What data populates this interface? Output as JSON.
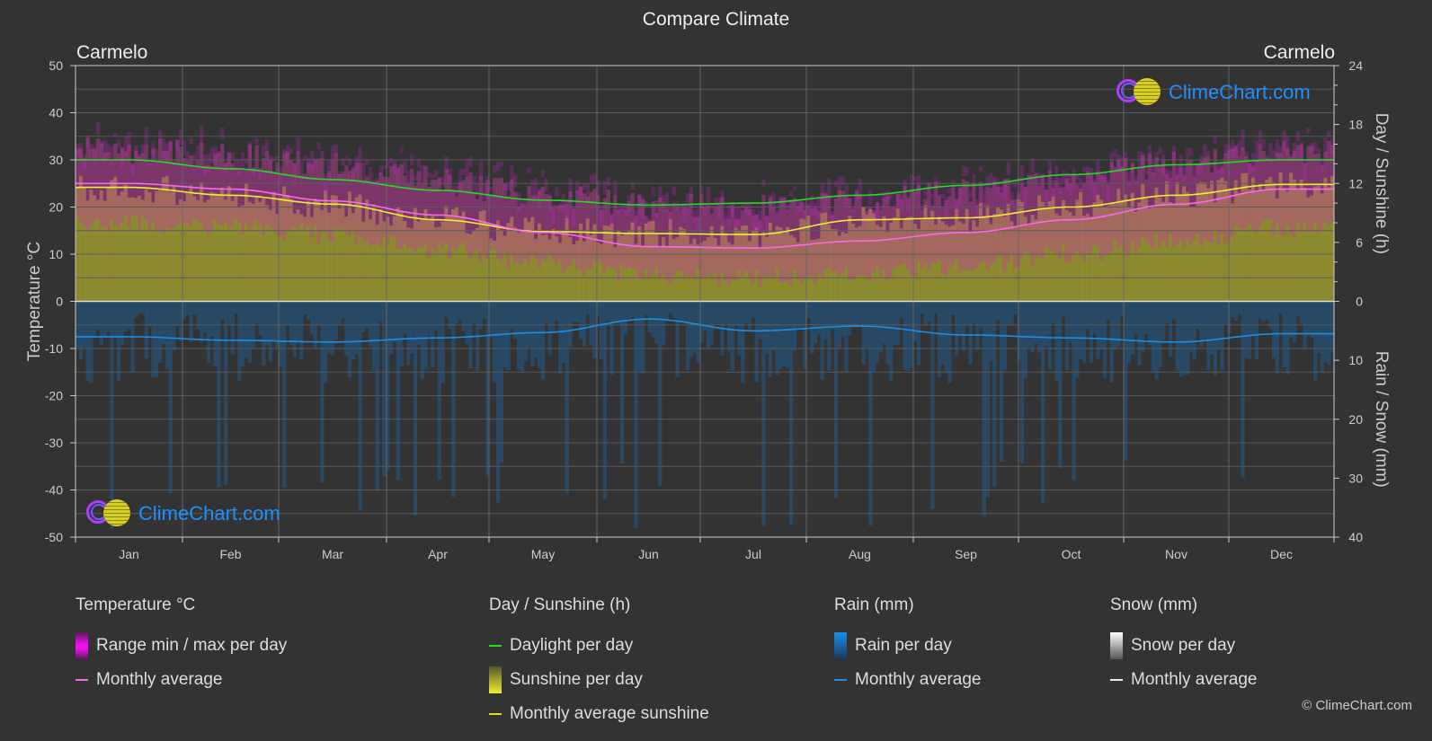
{
  "title": "Compare Climate",
  "location_left": "Carmelo",
  "location_right": "Carmelo",
  "watermark": "ClimeChart.com",
  "copyright": "© ClimeChart.com",
  "legend": {
    "temperature": {
      "title": "Temperature °C",
      "range": "Range min / max per day",
      "avg": "Monthly average"
    },
    "sunshine": {
      "title": "Day / Sunshine (h)",
      "daylight": "Daylight per day",
      "sunshine": "Sunshine per day",
      "avg": "Monthly average sunshine"
    },
    "rain": {
      "title": "Rain (mm)",
      "per_day": "Rain per day",
      "avg": "Monthly average"
    },
    "snow": {
      "title": "Snow (mm)",
      "per_day": "Snow per day",
      "avg": "Monthly average"
    }
  },
  "colors": {
    "daylight": "#22dd22",
    "sunshine_avg": "#eeee33",
    "temp_avg": "#ff66ee",
    "rain_avg": "#1a8fe8",
    "temp_range": "#cc22cc",
    "sunshine_fill": "#9a9a2a",
    "rain_fill": "#1f5a8a",
    "grid": "#5a5a5a",
    "axis": "#cccccc"
  },
  "chart_data": {
    "type": "area",
    "title": "Compare Climate",
    "categories": [
      "Jan",
      "Feb",
      "Mar",
      "Apr",
      "May",
      "Jun",
      "Jul",
      "Aug",
      "Sep",
      "Oct",
      "Nov",
      "Dec"
    ],
    "y_left": {
      "label": "Temperature °C",
      "range": [
        -50,
        50
      ],
      "ticks": [
        50,
        40,
        30,
        20,
        10,
        0,
        -10,
        -20,
        -30,
        -40,
        -50
      ]
    },
    "y_right_top": {
      "label": "Day / Sunshine (h)",
      "range": [
        0,
        24
      ],
      "ticks": [
        24,
        18,
        12,
        6,
        0
      ]
    },
    "y_right_bottom": {
      "label": "Rain / Snow (mm)",
      "range": [
        0,
        40
      ],
      "ticks": [
        0,
        10,
        20,
        30,
        40
      ]
    },
    "grid": true,
    "legend": "bottom",
    "series": [
      {
        "name": "Daylight per day",
        "axis": "hours",
        "values": [
          14.4,
          13.5,
          12.4,
          11.3,
          10.3,
          9.8,
          10.0,
          10.8,
          11.8,
          12.9,
          13.9,
          14.4
        ]
      },
      {
        "name": "Monthly average sunshine",
        "axis": "hours",
        "values": [
          11.6,
          10.8,
          9.9,
          8.3,
          7.1,
          6.9,
          6.8,
          8.3,
          8.5,
          9.6,
          10.8,
          11.9
        ]
      },
      {
        "name": "Temperature monthly average",
        "axis": "celsius",
        "values": [
          25.0,
          23.8,
          21.3,
          18.3,
          14.6,
          11.6,
          11.3,
          12.8,
          14.6,
          17.3,
          20.6,
          23.8
        ]
      },
      {
        "name": "Temperature daily max (approx)",
        "axis": "celsius",
        "values": [
          28.0,
          26.8,
          24.5,
          21.5,
          18.5,
          16.0,
          15.8,
          17.0,
          19.0,
          22.0,
          25.0,
          27.8
        ]
      },
      {
        "name": "Temperature daily min (approx)",
        "axis": "celsius",
        "values": [
          18.5,
          17.8,
          16.0,
          13.0,
          10.0,
          7.5,
          7.0,
          8.0,
          9.5,
          12.0,
          15.0,
          17.5
        ]
      },
      {
        "name": "Rain monthly average",
        "axis": "mm",
        "values": [
          6.0,
          6.6,
          6.9,
          6.2,
          5.3,
          3.0,
          5.0,
          4.2,
          5.7,
          6.2,
          6.9,
          5.5
        ]
      }
    ]
  }
}
